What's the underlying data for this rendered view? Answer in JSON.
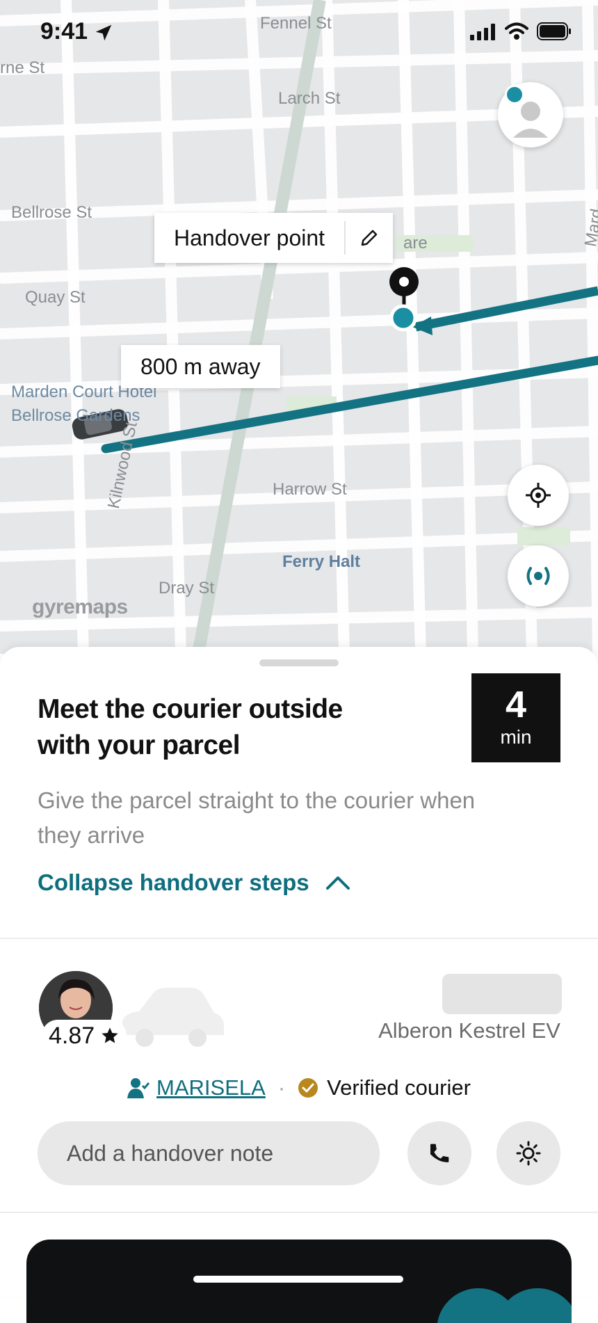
{
  "status_bar": {
    "time": "9:41"
  },
  "map": {
    "streets": [
      "Fennel St",
      "rne St",
      "Larch St",
      "Bellrose St",
      "Quay St",
      "Harrow St",
      "Kilnwood St",
      "Dray St",
      "Mard"
    ],
    "pois": [
      "Marden Court Hotel",
      "Bellrose Gardens",
      "are"
    ],
    "station": "Ferry Halt",
    "watermark": "gyremaps",
    "handover_label": "Handover point",
    "distance_label": "800 m away",
    "route_color": "#137383",
    "accent_color": "#1a8fa3"
  },
  "sheet": {
    "title_line1": "Meet the courier outside",
    "title_line2": "with your parcel",
    "eta_value": "4",
    "eta_unit": "min",
    "subtitle": "Give the parcel straight to the courier when they arrive",
    "collapse_label": "Collapse handover steps",
    "courier": {
      "rating": "4.87",
      "vehicle": "Alberon Kestrel EV",
      "name": "MARISELA",
      "separator": "·",
      "verified_label": "Verified courier"
    },
    "note_placeholder": "Add a handover note"
  },
  "icons": [
    "location-arrow-icon",
    "cellular-signal-icon",
    "wifi-icon",
    "battery-icon",
    "profile-icon",
    "edit-pencil-icon",
    "locate-me-icon",
    "broadcast-icon",
    "chevron-up-icon",
    "star-icon",
    "person-check-icon",
    "verified-badge-icon",
    "phone-icon",
    "brightness-icon"
  ]
}
